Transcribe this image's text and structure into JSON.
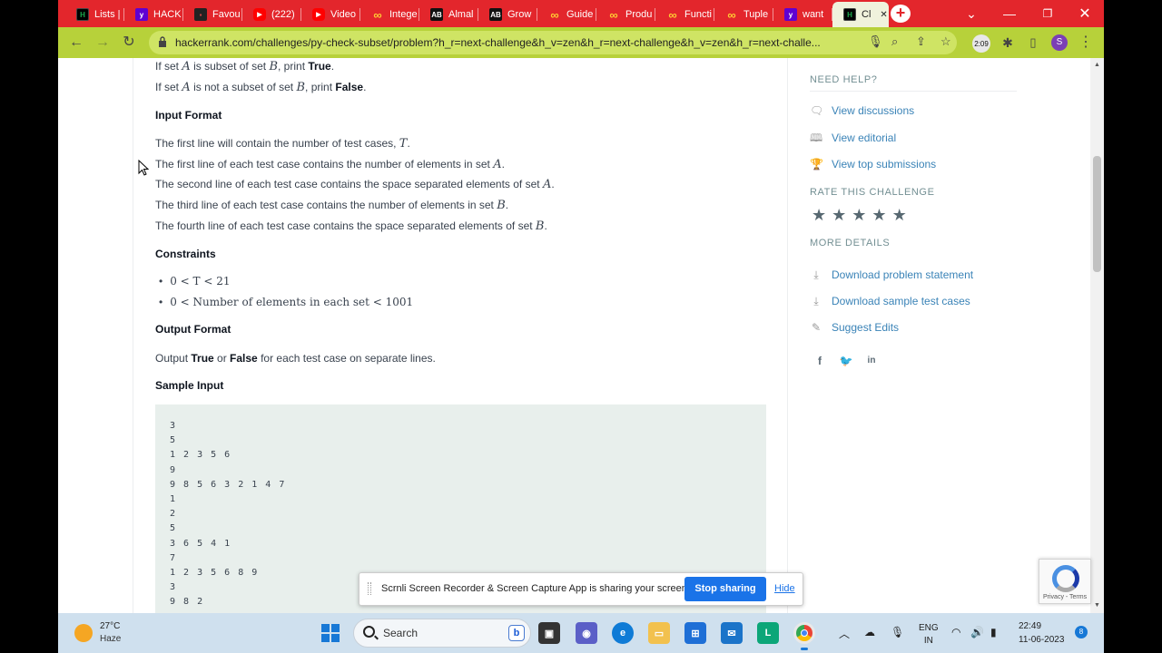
{
  "browser": {
    "tabs": [
      {
        "label": "Lists |",
        "favicon": "hr-icon"
      },
      {
        "label": "HACK",
        "favicon": "yahoo-icon"
      },
      {
        "label": "Favou",
        "favicon": "dark-page-icon"
      },
      {
        "label": "(222)",
        "favicon": "youtube-icon"
      },
      {
        "label": "Video",
        "favicon": "youtube-icon"
      },
      {
        "label": "Intege",
        "favicon": "infinity-icon"
      },
      {
        "label": "Almal",
        "favicon": "ab-icon"
      },
      {
        "label": "Grow",
        "favicon": "ab-icon"
      },
      {
        "label": "Guide",
        "favicon": "infinity-icon"
      },
      {
        "label": "Produ",
        "favicon": "infinity-icon"
      },
      {
        "label": "Functi",
        "favicon": "infinity-icon"
      },
      {
        "label": "Tuple",
        "favicon": "infinity-icon"
      },
      {
        "label": "want",
        "favicon": "yahoo-icon"
      },
      {
        "label": "Cl",
        "favicon": "hr-icon",
        "active": true
      }
    ],
    "url": "hackerrank.com/challenges/py-check-subset/problem?h_r=next-challenge&h_v=zen&h_r=next-challenge&h_v=zen&h_r=next-challe...",
    "avatar_letter": "S",
    "extension_badge": "2:09",
    "accent_color": "#e3262c",
    "toolbar_color": "#b7d13a"
  },
  "problem": {
    "line_subset_true_pre": "If set ",
    "line_subset_true_a": "A",
    "line_subset_true_mid": " is subset of set ",
    "line_subset_true_b": "B",
    "line_subset_true_post": ", print ",
    "line_subset_true_value": "True",
    "line_subset_false_pre": "If set ",
    "line_subset_false_a": "A",
    "line_subset_false_mid": " is not a subset of set ",
    "line_subset_false_b": "B",
    "line_subset_false_post": ", print ",
    "line_subset_false_value": "False",
    "input_format_heading": "Input Format",
    "input_lines": [
      {
        "text": "The first line will contain the number of test cases, ",
        "var": "T"
      },
      {
        "text": "The first line of each test case contains the number of elements in set ",
        "var": "A"
      },
      {
        "text": "The second line of each test case contains the space separated elements of set ",
        "var": "A"
      },
      {
        "text": "The third line of each test case contains the number of elements in set ",
        "var": "B"
      },
      {
        "text": "The fourth line of each test case contains the space separated elements of set ",
        "var": "B"
      }
    ],
    "constraints_heading": "Constraints",
    "constraints": [
      "0 < T < 21",
      "0 < Number of elements in each set < 1001"
    ],
    "output_format_heading": "Output Format",
    "output_pre": "Output ",
    "output_true": "True",
    "output_or": " or ",
    "output_false": "False",
    "output_post": " for each test case on separate lines.",
    "sample_input_heading": "Sample Input",
    "sample_input": "3\n5\n1 2 3 5 6\n9\n9 8 5 6 3 2 1 4 7\n1\n2\n5\n3 6 5 4 1\n7\n1 2 3 5 6 8 9\n3\n9 8 2"
  },
  "sidebar": {
    "need_help_heading": "NEED HELP?",
    "help_links": [
      "View discussions",
      "View editorial",
      "View top submissions"
    ],
    "rate_heading": "RATE THIS CHALLENGE",
    "stars": 5,
    "more_details_heading": "MORE DETAILS",
    "detail_links": [
      "Download problem statement",
      "Download sample test cases",
      "Suggest Edits"
    ],
    "social": [
      "facebook-icon",
      "twitter-icon",
      "linkedin-icon"
    ]
  },
  "share_bar": {
    "message": "Scrnli Screen Recorder & Screen Capture App is sharing your screen.",
    "stop_label": "Stop sharing",
    "hide_label": "Hide"
  },
  "recaptcha": {
    "text": "Privacy - Terms"
  },
  "taskbar": {
    "weather_temp": "27°C",
    "weather_cond": "Haze",
    "search_placeholder": "Search",
    "lang_line1": "ENG",
    "lang_line2": "IN",
    "time": "22:49",
    "date": "11-06-2023",
    "notification_count": "8"
  }
}
